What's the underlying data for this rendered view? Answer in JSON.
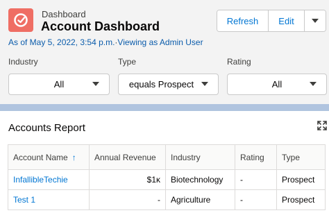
{
  "header": {
    "breadcrumb": "Dashboard",
    "title": "Account Dashboard",
    "as_of": "As of May 5, 2022, 3:54 p.m.",
    "separator": "·",
    "viewing_as": "Viewing as Admin User",
    "icon": "dashboard-icon",
    "icon_color": "#ef6e64"
  },
  "actions": {
    "refresh_label": "Refresh",
    "edit_label": "Edit",
    "more_icon": "chevron-down-icon"
  },
  "filters": [
    {
      "label": "Industry",
      "value": "All"
    },
    {
      "label": "Type",
      "value": "equals Prospect"
    },
    {
      "label": "Rating",
      "value": "All"
    }
  ],
  "report": {
    "title": "Accounts Report",
    "expand_icon": "expand-icon",
    "columns": [
      "Account Name",
      "Annual Revenue",
      "Industry",
      "Rating",
      "Type"
    ],
    "sort_indicator": "↑",
    "rows": [
      {
        "name": "InfallibleTechie",
        "revenue": "$1ĸ",
        "industry": "Biotechnology",
        "rating": "-",
        "type": "Prospect"
      },
      {
        "name": "Test 1",
        "revenue": "-",
        "industry": "Agriculture",
        "rating": "-",
        "type": "Prospect"
      }
    ]
  },
  "colors": {
    "link": "#0176d3",
    "band": "#b0c4df"
  }
}
